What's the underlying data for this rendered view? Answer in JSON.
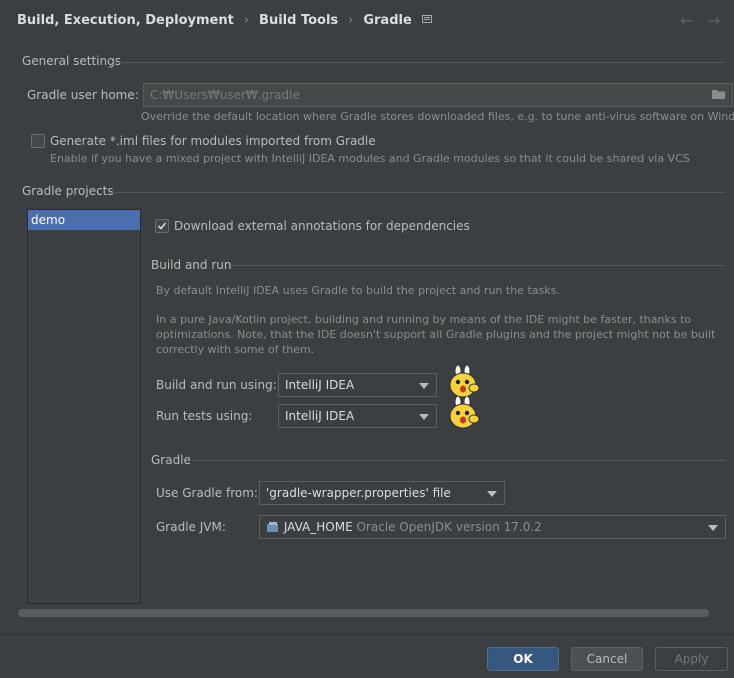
{
  "breadcrumb": {
    "item1": "Build, Execution, Deployment",
    "item2": "Build Tools",
    "item3": "Gradle",
    "sep": "›"
  },
  "general": {
    "title": "General settings",
    "user_home_label": "Gradle user home:",
    "user_home_value": "C:₩Users₩user₩.gradle",
    "user_home_hint": "Override the default location where Gradle stores downloaded files, e.g. to tune anti-virus software on Windows",
    "iml_label": "Generate *.iml files for modules imported from Gradle",
    "iml_hint": "Enable if you have a mixed project with IntelliJ IDEA modules and Gradle modules so that it could be shared via VCS"
  },
  "projects": {
    "title": "Gradle projects",
    "items": [
      "demo"
    ]
  },
  "settings": {
    "download_annotations_label": "Download external annotations for dependencies",
    "build_and_run_title": "Build and run",
    "desc1": "By default IntelliJ IDEA uses Gradle to build the project and run the tasks.",
    "desc2_line1": "In a pure Java/Kotlin project, building and running by means of the IDE might be faster, thanks to",
    "desc2_line2": "optimizations. Note, that the IDE doesn't support all Gradle plugins and the project might not be built",
    "desc2_line3": "correctly with some of them.",
    "build_run_using_label": "Build and run using:",
    "build_run_using_value": "IntelliJ IDEA",
    "run_tests_label": "Run tests using:",
    "run_tests_value": "IntelliJ IDEA",
    "gradle_title": "Gradle",
    "use_gradle_from_label": "Use Gradle from:",
    "use_gradle_from_value": "'gradle-wrapper.properties' file",
    "jvm_label": "Gradle JVM:",
    "jvm_name": "JAVA_HOME",
    "jvm_detail": "Oracle OpenJDK version 17.0.2"
  },
  "buttons": {
    "ok": "OK",
    "cancel": "Cancel",
    "apply": "Apply"
  },
  "colors": {
    "background": "#3c3f41",
    "selection": "#4b6eaf",
    "ok_button": "#365880"
  },
  "icons": [
    "back-arrow-icon",
    "forward-arrow-icon",
    "folder-icon",
    "checkbox-icon",
    "dropdown-arrow-icon",
    "jdk-icon",
    "sticker-emoji-icon"
  ]
}
